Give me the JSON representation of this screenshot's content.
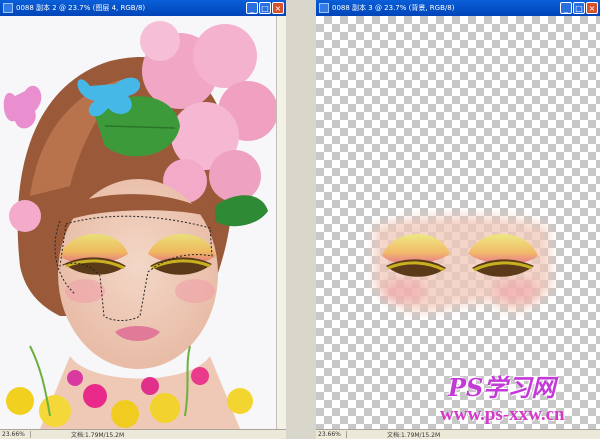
{
  "left_window": {
    "title": "0088 副本 2 @ 23.7% (图层 4, RGB/8)",
    "zoom": "23.66%",
    "doc_info": "文档:1.79M/15.2M"
  },
  "right_window": {
    "title": "0088 副本 3 @ 23.7% (背景, RGB/8)",
    "zoom": "23.66%",
    "doc_info": "文档:1.79M/15.2M"
  },
  "window_controls": {
    "minimize": "_",
    "maximize": "□",
    "close": "×"
  },
  "watermark": {
    "brand": "PS学习网",
    "url": "www.ps-xxw.cn"
  },
  "colors": {
    "titlebar": "#0a5fd8",
    "brand_purple": "#c43ad8",
    "url_magenta": "#d23ac8"
  }
}
